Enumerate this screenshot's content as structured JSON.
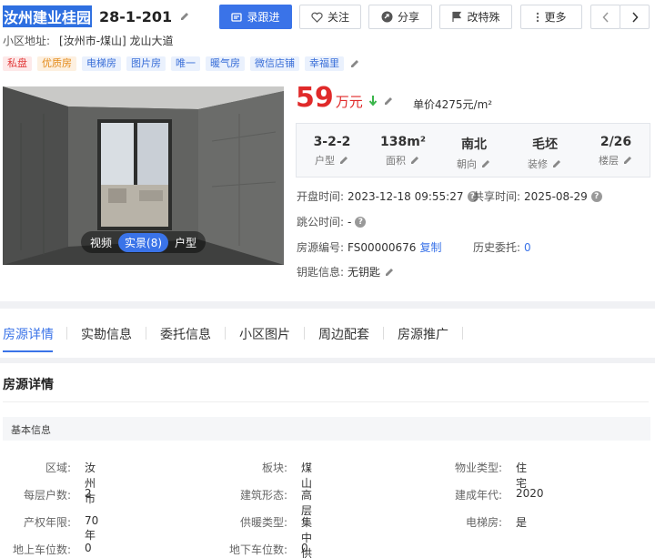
{
  "header": {
    "community": "汝州建业桂园",
    "unit": "28-1-201",
    "buttons": {
      "follow_up": "录跟进",
      "favorite": "关注",
      "share": "分享",
      "special": "改特殊",
      "more": "更多"
    }
  },
  "address": {
    "label": "小区地址:",
    "value": "[汝州市-煤山]  龙山大道"
  },
  "tags": [
    "私盘",
    "优质房",
    "电梯房",
    "图片房",
    "唯一",
    "暖气房",
    "微信店铺",
    "幸福里"
  ],
  "photo": {
    "tabs": [
      "视频",
      "实景(8)",
      "户型"
    ],
    "active_tab": "实景(8)"
  },
  "price": {
    "total": "59",
    "unit": "万元",
    "unit_price": "单价4275元/m²"
  },
  "stats": [
    {
      "value": "3-2-2",
      "label": "户型"
    },
    {
      "value": "138m²",
      "label": "面积"
    },
    {
      "value": "南北",
      "label": "朝向"
    },
    {
      "value": "毛坯",
      "label": "装修"
    },
    {
      "value": "2/26",
      "label": "楼层"
    }
  ],
  "details": {
    "open_time_label": "开盘时间:",
    "open_time": "2023-12-18 09:55:27",
    "share_time_label": "共享时间:",
    "share_time": "2025-08-29",
    "skip_time_label": "跳公时间:",
    "skip_time": "-",
    "listing_no_label": "房源编号:",
    "listing_no": "FS00000676",
    "copy": "复制",
    "history_label": "历史委托:",
    "history": "0",
    "key_label": "钥匙信息:",
    "key": "无钥匙"
  },
  "tabs": [
    "房源详情",
    "实勘信息",
    "委托信息",
    "小区图片",
    "周边配套",
    "房源推广"
  ],
  "section": {
    "title": "房源详情",
    "sub": "基本信息"
  },
  "basic": {
    "r1": [
      [
        "区域:",
        "汝州市"
      ],
      [
        "板块:",
        "煤山"
      ],
      [
        "物业类型:",
        "住宅"
      ]
    ],
    "r2": [
      [
        "每层户数:",
        "2"
      ],
      [
        "建筑形态:",
        "高层"
      ],
      [
        "建成年代:",
        "2020"
      ]
    ],
    "r3": [
      [
        "产权年限:",
        "70年"
      ],
      [
        "供暖类型:",
        "集中供暖"
      ],
      [
        "电梯房:",
        "是"
      ]
    ],
    "r4": [
      [
        "地上车位数:",
        "0"
      ],
      [
        "地下车位数:",
        "0"
      ]
    ]
  },
  "colors": {
    "primary": "#3a73e8",
    "price": "#e02a2a",
    "down": "#3ab54a"
  }
}
